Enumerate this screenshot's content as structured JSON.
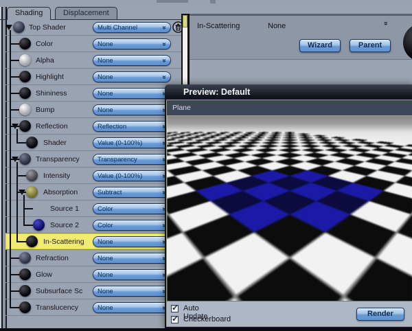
{
  "tabs": [
    {
      "label": "Shading",
      "active": true
    },
    {
      "label": "Displacement",
      "active": false
    }
  ],
  "shader_tree": {
    "rows": [
      {
        "label": "Top Shader",
        "value": "Multi Channel",
        "level": 0,
        "expander": true,
        "trash": true,
        "highlighted": false,
        "sphere": {
          "hi": "#7d8299",
          "lo": "#272c42"
        }
      },
      {
        "label": "Color",
        "value": "None",
        "level": 1,
        "expander": false,
        "trash": false,
        "highlighted": false,
        "sphere": {
          "hi": "#4a4a52",
          "lo": "#000006"
        }
      },
      {
        "label": "Alpha",
        "value": "None",
        "level": 1,
        "expander": false,
        "trash": false,
        "highlighted": false,
        "sphere": {
          "hi": "#ffffff",
          "lo": "#9fa0a8"
        }
      },
      {
        "label": "Highlight",
        "value": "None",
        "level": 1,
        "expander": false,
        "trash": false,
        "highlighted": false,
        "sphere": {
          "hi": "#4a4a52",
          "lo": "#000006"
        }
      },
      {
        "label": "Shininess",
        "value": "None",
        "level": 1,
        "expander": false,
        "trash": false,
        "highlighted": false,
        "sphere": {
          "hi": "#4a4a52",
          "lo": "#000006"
        }
      },
      {
        "label": "Bump",
        "value": "None",
        "level": 1,
        "expander": false,
        "trash": false,
        "highlighted": false,
        "sphere": {
          "hi": "#fdfdff",
          "lo": "#9fa0a8"
        }
      },
      {
        "label": "Reflection",
        "value": "Reflection",
        "level": 1,
        "expander": true,
        "trash": false,
        "highlighted": false,
        "sphere": {
          "hi": "#4a4a52",
          "lo": "#000006"
        }
      },
      {
        "label": "Shader",
        "value": "Value (0-100%)",
        "level": 2,
        "expander": false,
        "trash": false,
        "highlighted": false,
        "sphere": {
          "hi": "#4a4a52",
          "lo": "#000006"
        }
      },
      {
        "label": "Transparency",
        "value": "Transparency",
        "level": 1,
        "expander": true,
        "trash": false,
        "highlighted": false,
        "sphere": {
          "hi": "#767b92",
          "lo": "#23283c"
        }
      },
      {
        "label": "Intensity",
        "value": "Value (0-100%)",
        "level": 2,
        "expander": false,
        "trash": false,
        "highlighted": false,
        "sphere": {
          "hi": "#9a9aa0",
          "lo": "#3c3c44"
        }
      },
      {
        "label": "Absorption",
        "value": "Subtract",
        "level": 2,
        "expander": true,
        "trash": false,
        "highlighted": false,
        "sphere": {
          "hi": "#c9c67e",
          "lo": "#6f6d2e"
        }
      },
      {
        "label": "Source 1",
        "value": "Color",
        "level": 3,
        "expander": false,
        "trash": false,
        "highlighted": false,
        "sphere": null
      },
      {
        "label": "Source 2",
        "value": "Color",
        "level": 3,
        "expander": false,
        "trash": false,
        "highlighted": false,
        "sphere": {
          "hi": "#4646c8",
          "lo": "#0b0b5e"
        }
      },
      {
        "label": "In-Scattering",
        "value": "None",
        "level": 2,
        "expander": false,
        "trash": false,
        "highlighted": true,
        "sphere": {
          "hi": "#4a4a52",
          "lo": "#000006"
        }
      },
      {
        "label": "Refraction",
        "value": "None",
        "level": 1,
        "expander": false,
        "trash": false,
        "highlighted": false,
        "sphere": {
          "hi": "#7d8299",
          "lo": "#2a2f46"
        }
      },
      {
        "label": "Glow",
        "value": "None",
        "level": 1,
        "expander": false,
        "trash": false,
        "highlighted": false,
        "sphere": {
          "hi": "#4a4a52",
          "lo": "#000006"
        }
      },
      {
        "label": "Subsurface Sc",
        "value": "None",
        "level": 1,
        "expander": false,
        "trash": false,
        "highlighted": false,
        "sphere": {
          "hi": "#4a4a52",
          "lo": "#000006"
        }
      },
      {
        "label": "Translucency",
        "value": "None",
        "level": 1,
        "expander": false,
        "trash": false,
        "highlighted": false,
        "sphere": {
          "hi": "#4a4a52",
          "lo": "#000006"
        }
      }
    ]
  },
  "right_panel": {
    "label": "In-Scattering",
    "value": "None",
    "wizard_button": "Wizard",
    "parent_button": "Parent"
  },
  "preview": {
    "window_title": "Preview: Default",
    "object_name": "Plane",
    "checkboxes": [
      {
        "label": "Auto Update",
        "checked": true
      },
      {
        "label": "Checkerboard",
        "checked": true
      }
    ],
    "render_button": "Render",
    "blue_tiles": [
      [
        10,
        11
      ],
      [
        11,
        10
      ],
      [
        11,
        12
      ],
      [
        12,
        11
      ],
      [
        12,
        13
      ],
      [
        13,
        12
      ],
      [
        13,
        10
      ],
      [
        10,
        13
      ]
    ],
    "navy_tiles": [
      [
        11,
        11
      ],
      [
        12,
        12
      ],
      [
        12,
        10
      ],
      [
        10,
        12
      ],
      [
        11,
        13
      ],
      [
        13,
        11
      ]
    ]
  },
  "colors": {
    "panel_bg": "#9aa3b1",
    "highlight_row": "#f2eb72",
    "dropdown_border": "#16365f",
    "dropdown_text": "#0d2950",
    "title_bar": "#10141c",
    "preview_frame": "#a6a667",
    "blue_tile": "#1a1aa6",
    "navy_tile": "#0b0b3e",
    "checker_white": "#f2f2f2",
    "checker_black": "#0c0c0c"
  },
  "glyphs": {
    "dropdown_chevron": "«",
    "panel_chevron": "«",
    "check": "✓"
  }
}
